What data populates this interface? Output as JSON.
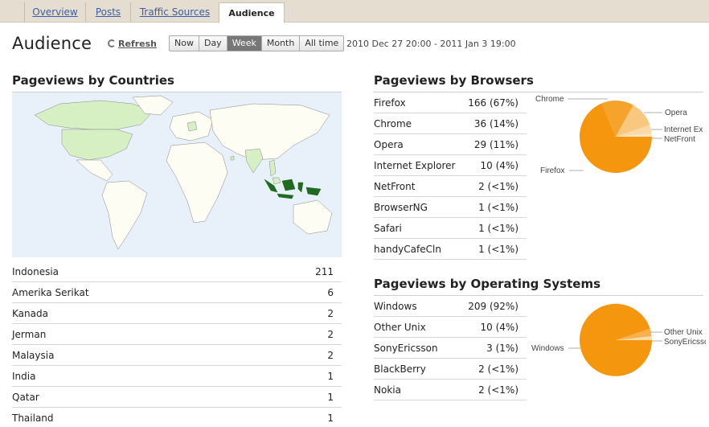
{
  "tabs": [
    {
      "label": "Overview"
    },
    {
      "label": "Posts"
    },
    {
      "label": "Traffic Sources"
    },
    {
      "label": "Audience"
    }
  ],
  "header": {
    "title": "Audience",
    "refresh_label": "Refresh",
    "ranges": [
      "Now",
      "Day",
      "Week",
      "Month",
      "All time"
    ],
    "selected_range": "Week",
    "date_range": "2010 Dec 27 20:00 - 2011 Jan 3 19:00"
  },
  "countries": {
    "title": "Pageviews by Countries",
    "rows": [
      {
        "label": "Indonesia",
        "value": "211"
      },
      {
        "label": "Amerika Serikat",
        "value": "6"
      },
      {
        "label": "Kanada",
        "value": "2"
      },
      {
        "label": "Jerman",
        "value": "2"
      },
      {
        "label": "Malaysia",
        "value": "2"
      },
      {
        "label": "India",
        "value": "1"
      },
      {
        "label": "Qatar",
        "value": "1"
      },
      {
        "label": "Thailand",
        "value": "1"
      }
    ]
  },
  "browsers": {
    "title": "Pageviews by Browsers",
    "rows": [
      {
        "label": "Firefox",
        "value": "166 (67%)"
      },
      {
        "label": "Chrome",
        "value": "36 (14%)"
      },
      {
        "label": "Opera",
        "value": "29 (11%)"
      },
      {
        "label": "Internet Explorer",
        "value": "10 (4%)"
      },
      {
        "label": "NetFront",
        "value": "2 (<1%)"
      },
      {
        "label": "BrowserNG",
        "value": "1 (<1%)"
      },
      {
        "label": "Safari",
        "value": "1 (<1%)"
      },
      {
        "label": "handyCafeCln",
        "value": "1 (<1%)"
      }
    ],
    "pie_labels": [
      "Firefox",
      "Chrome",
      "Opera",
      "Internet Ex",
      "NetFront"
    ]
  },
  "os": {
    "title": "Pageviews by Operating Systems",
    "rows": [
      {
        "label": "Windows",
        "value": "209 (92%)"
      },
      {
        "label": "Other Unix",
        "value": "10 (4%)"
      },
      {
        "label": "SonyEricsson",
        "value": "3 (1%)"
      },
      {
        "label": "BlackBerry",
        "value": "2 (<1%)"
      },
      {
        "label": "Nokia",
        "value": "2 (<1%)"
      }
    ],
    "pie_labels": [
      "Windows",
      "Other Unix",
      "SonyEricsson"
    ]
  },
  "colors": {
    "accent_orange": "#f4970f",
    "slice_2": "#f7b24e",
    "slice_3": "#f9c87f",
    "slice_4": "#fbd9a8",
    "map_land": "#fdfdf3",
    "map_water": "#e8f1fa",
    "map_highlight_light": "#d6f0c4",
    "map_highlight_dark": "#1f6b1f"
  }
}
